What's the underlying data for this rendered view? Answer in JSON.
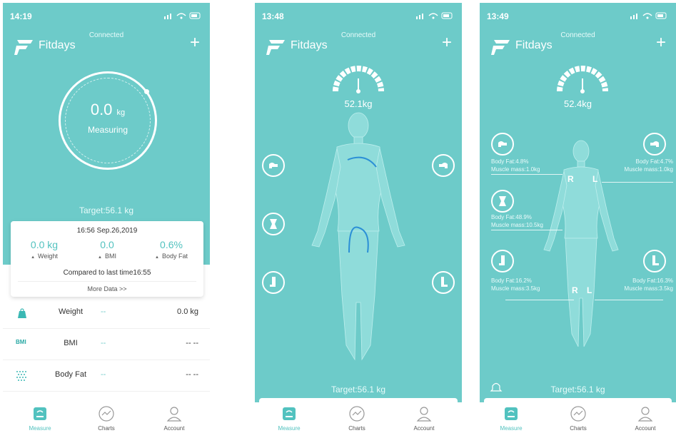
{
  "colors": {
    "teal": "#6dcbc9",
    "accent": "#52c2bf"
  },
  "phone1": {
    "status": {
      "time": "14:19"
    },
    "connected": "Connected",
    "app_name": "Fitdays",
    "plus": "+",
    "reading": {
      "value": "0.0",
      "unit": "kg",
      "state": "Measuring"
    },
    "target": "Target:56.1 kg",
    "card": {
      "datetime": "16:56 Sep.26,2019",
      "stats": [
        {
          "value": "0.0 kg",
          "label": "Weight"
        },
        {
          "value": "0.0",
          "label": "BMI"
        },
        {
          "value": "0.6%",
          "label": "Body Fat"
        }
      ],
      "compared": "Compared to last time16:55",
      "more": "More Data >>"
    },
    "metrics": [
      {
        "icon": "weight-icon",
        "icon_text": "kg",
        "name": "Weight",
        "dash": "--",
        "value": "0.0 kg"
      },
      {
        "icon": "bmi-icon",
        "icon_text": "BMI",
        "name": "BMI",
        "dash": "--",
        "value": "-- --"
      },
      {
        "icon": "body-fat-icon",
        "icon_text": "",
        "name": "Body Fat",
        "dash": "--",
        "value": "-- --"
      }
    ]
  },
  "phone2": {
    "status": {
      "time": "13:48"
    },
    "connected": "Connected",
    "app_name": "Fitdays",
    "plus": "+",
    "weight": "52.1kg",
    "target": "Target:56.1 kg"
  },
  "phone3": {
    "status": {
      "time": "13:49"
    },
    "connected": "Connected",
    "app_name": "Fitdays",
    "plus": "+",
    "weight": "52.4kg",
    "target": "Target:56.1 kg",
    "segments": {
      "right_arm": {
        "fat": "Body Fat:4.8%",
        "muscle": "Muscle mass:1.0kg"
      },
      "left_arm": {
        "fat": "Body Fat:4.7%",
        "muscle": "Muscle mass:1.0kg"
      },
      "trunk": {
        "fat": "Body Fat:48.9%",
        "muscle": "Muscle mass:10.5kg"
      },
      "right_leg": {
        "fat": "Body Fat:16.2%",
        "muscle": "Muscle mass:3.5kg"
      },
      "left_leg": {
        "fat": "Body Fat:16.3%",
        "muscle": "Muscle mass:3.5kg"
      }
    },
    "side_r": "R",
    "side_l": "L"
  },
  "tabs": [
    {
      "label": "Measure",
      "icon": "scale-icon"
    },
    {
      "label": "Charts",
      "icon": "charts-icon"
    },
    {
      "label": "Account",
      "icon": "account-icon"
    }
  ]
}
